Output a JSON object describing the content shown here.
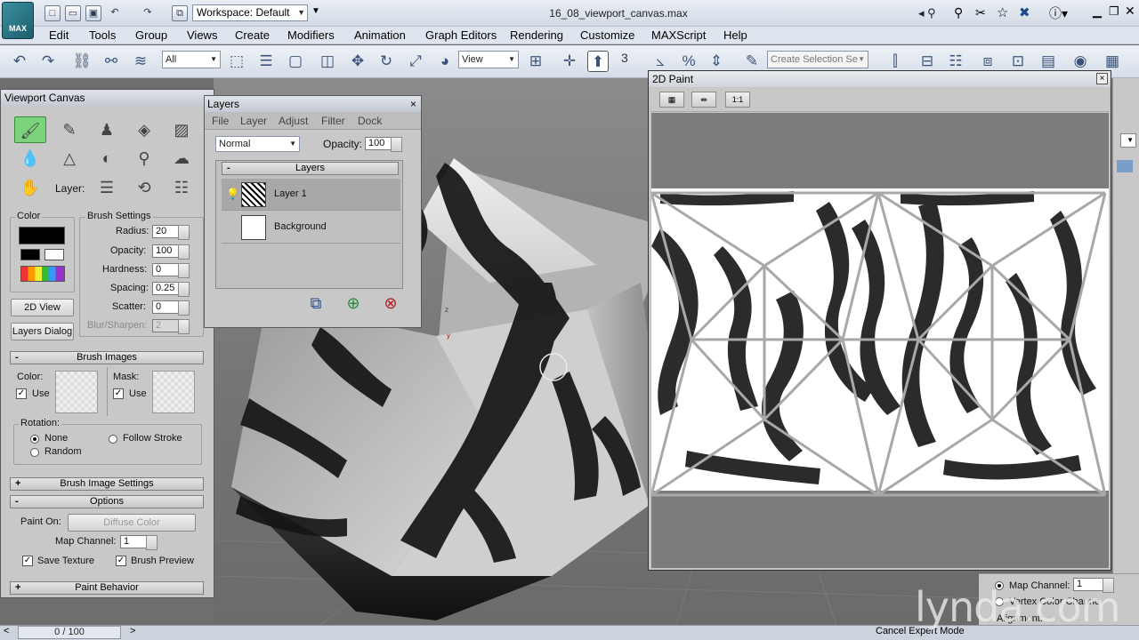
{
  "app": {
    "logo_label": "MAX",
    "workspace": "Workspace: Default",
    "file_title": "16_08_viewport_canvas.max"
  },
  "menu": [
    "Edit",
    "Tools",
    "Group",
    "Views",
    "Create",
    "Modifiers",
    "Animation",
    "Graph Editors",
    "Rendering",
    "Customize",
    "MAXScript",
    "Help"
  ],
  "toolbar": {
    "filter": "All",
    "ref_coord": "View",
    "snap_label": "3",
    "selection_set_placeholder": "Create Selection Se"
  },
  "viewport_canvas": {
    "title": "Viewport Canvas",
    "layer_label": "Layer:",
    "color_group": "Color",
    "brush_settings": {
      "title": "Brush Settings",
      "radius_label": "Radius:",
      "radius": "20",
      "opacity_label": "Opacity:",
      "opacity": "100",
      "hardness_label": "Hardness:",
      "hardness": "0",
      "spacing_label": "Spacing:",
      "spacing": "0.25",
      "scatter_label": "Scatter:",
      "scatter": "0",
      "blur_label": "Blur/Sharpen:",
      "blur": "2"
    },
    "view2d_button": "2D View",
    "layers_dialog_button": "Layers Dialog",
    "brush_images": {
      "title": "Brush Images",
      "color_label": "Color:",
      "mask_label": "Mask:",
      "use_label": "Use",
      "rotation_label": "Rotation:",
      "none": "None",
      "follow_stroke": "Follow Stroke",
      "random": "Random"
    },
    "brush_image_settings": "Brush Image Settings",
    "options": {
      "title": "Options",
      "paint_on_label": "Paint On:",
      "paint_on": "Diffuse Color",
      "map_channel_label": "Map Channel:",
      "map_channel": "1",
      "save_texture": "Save Texture",
      "brush_preview": "Brush Preview"
    },
    "paint_behavior": "Paint Behavior"
  },
  "layers_dialog": {
    "title": "Layers",
    "close": "×",
    "menu": [
      "File",
      "Layer",
      "Adjust",
      "Filter",
      "Dock"
    ],
    "blend_mode": "Normal",
    "opacity_label": "Opacity:",
    "opacity": "100",
    "list_header": "Layers",
    "layers": [
      "Layer 1",
      "Background"
    ]
  },
  "paint2d": {
    "title": "2D Paint",
    "close": "×",
    "one_to_one": "1:1"
  },
  "command_panel": {
    "map_channel_label": "Map Channel:",
    "map_channel": "1",
    "vertex_color": "Vertex Color Channe",
    "alignment": "Alignment:"
  },
  "status": {
    "time_slider": "0 / 100",
    "cancel_expert": "Cancel Expert Mode",
    "watermark": "lynda.com"
  },
  "colors": {
    "selected_tool": "#7bd37b",
    "panel_bg": "#c8c8c8"
  }
}
